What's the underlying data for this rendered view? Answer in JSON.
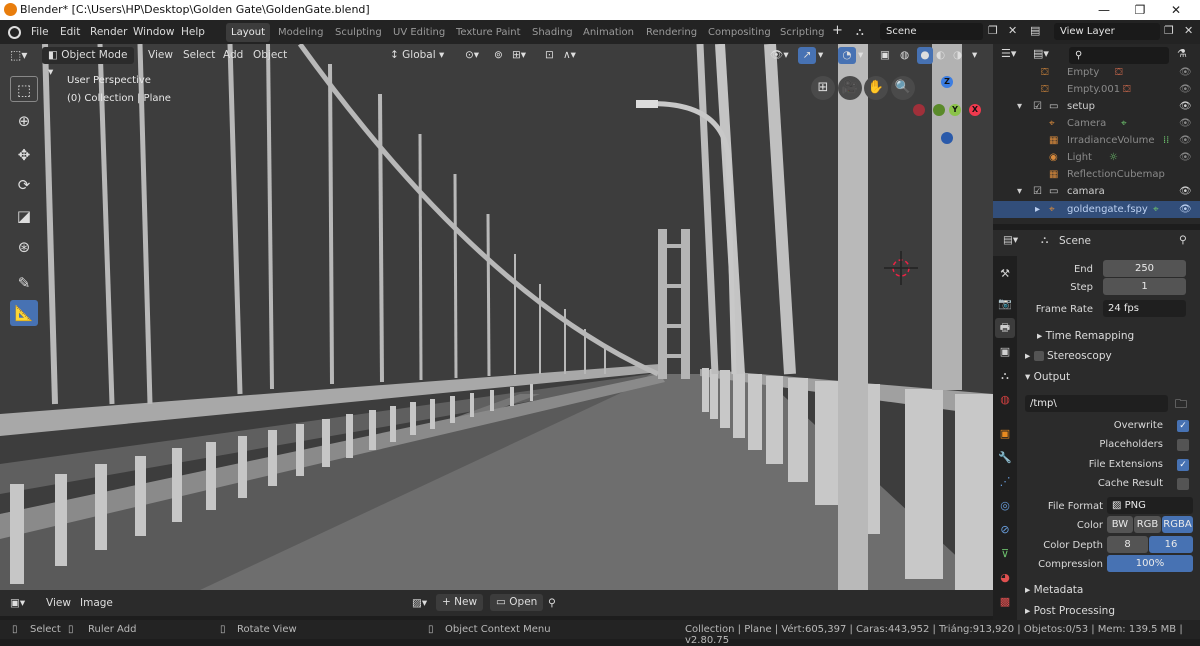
{
  "titlebar": {
    "title": "Blender* [C:\\Users\\HP\\Desktop\\Golden Gate\\GoldenGate.blend]",
    "minimize": "—",
    "maximize": "❐",
    "close": "✕"
  },
  "menu": {
    "items": [
      "File",
      "Edit",
      "Render",
      "Window",
      "Help"
    ]
  },
  "workspaces": [
    "Layout",
    "Modeling",
    "Sculpting",
    "UV Editing",
    "Texture Paint",
    "Shading",
    "Animation",
    "Rendering",
    "Compositing",
    "Scripting"
  ],
  "add_workspace": "+",
  "scene": {
    "label": "Scene"
  },
  "view_layer": {
    "label": "View Layer"
  },
  "viewport": {
    "mode": "Object Mode",
    "menus": [
      "View",
      "Select",
      "Add",
      "Object"
    ],
    "transform": "Global",
    "overlay_title": "User Perspective",
    "overlay_collection": "(0) Collection | Plane",
    "gizmo": {
      "z": "Z",
      "x": "X",
      "y": "Y"
    }
  },
  "outliner": {
    "search_placeholder": "",
    "rows": [
      {
        "label": "Empty",
        "selected": false
      },
      {
        "label": "Empty.001",
        "selected": false
      },
      {
        "label": "setup",
        "selected": false
      },
      {
        "label": "Camera",
        "selected": false
      },
      {
        "label": "IrradianceVolume",
        "selected": false
      },
      {
        "label": "Light",
        "selected": false
      },
      {
        "label": "ReflectionCubemap",
        "selected": false
      },
      {
        "label": "camara",
        "selected": false
      },
      {
        "label": "goldengate.fspy",
        "selected": true
      }
    ]
  },
  "properties": {
    "context": "Scene",
    "end_label": "End",
    "end_value": "250",
    "step_label": "Step",
    "step_value": "1",
    "frame_rate_label": "Frame Rate",
    "frame_rate_value": "24 fps",
    "time_remapping": "Time Remapping",
    "stereoscopy": "Stereoscopy",
    "output": "Output",
    "output_path": "/tmp\\",
    "overwrite": "Overwrite",
    "placeholders": "Placeholders",
    "file_extensions": "File Extensions",
    "cache_result": "Cache Result",
    "file_format_label": "File Format",
    "file_format_value": "PNG",
    "color_label": "Color",
    "color_options": [
      "BW",
      "RGB",
      "RGBA"
    ],
    "color_depth_label": "Color Depth",
    "color_depth_options": [
      "8",
      "16"
    ],
    "compression_label": "Compression",
    "compression_value": "100%",
    "compression_fraction": 1.0,
    "metadata": "Metadata",
    "post_processing": "Post Processing",
    "checks": {
      "overwrite": true,
      "placeholders": false,
      "file_extensions": true,
      "cache_result": false
    }
  },
  "image_editor": {
    "menus": [
      "View",
      "Image"
    ],
    "new": "New",
    "open": "Open"
  },
  "status": {
    "select": "Select",
    "ruler": "Ruler Add",
    "rotate": "Rotate View",
    "context_menu": "Object Context Menu",
    "info": "Collection | Plane | Vért:605,397 | Caras:443,952 | Triáng:913,920 | Objetos:0/53 | Mem: 139.5 MB | v2.80.75"
  },
  "colors": {
    "accent": "#4772b3",
    "viewport_bg": "#3d3d3d",
    "panel": "#2b2b2b"
  }
}
